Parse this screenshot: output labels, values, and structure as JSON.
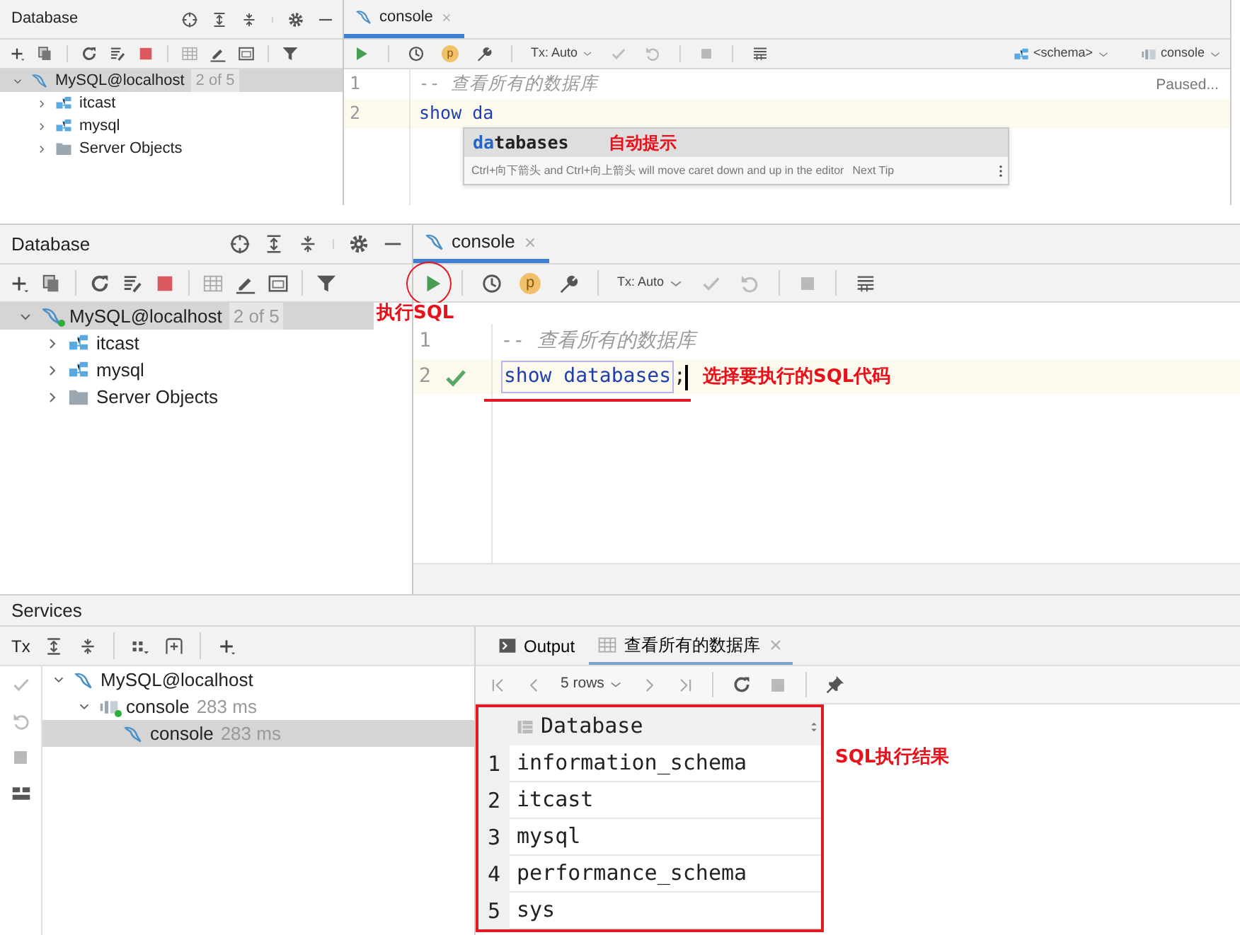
{
  "autocomplete_screenshot": {
    "database_panel": {
      "title": "Database",
      "tree": [
        {
          "label": "MySQL@localhost",
          "badge": "2 of 5",
          "kind": "connection",
          "connected": false,
          "expanded": true,
          "selected": true,
          "children": [
            {
              "label": "itcast",
              "kind": "schema",
              "expanded": false,
              "selected": false
            },
            {
              "label": "mysql",
              "kind": "schema",
              "expanded": false,
              "selected": false
            },
            {
              "label": "Server Objects",
              "kind": "folder",
              "expanded": false,
              "selected": false
            }
          ]
        }
      ]
    },
    "editor": {
      "tab": {
        "label": "console",
        "selected": true
      },
      "tx_mode": "Tx: Auto",
      "profile_badge": "p",
      "schema": "<schema>",
      "session": "console",
      "status": "Paused...",
      "lines": [
        {
          "number": "1",
          "kind": "comment",
          "text": "-- 查看所有的数据库",
          "current": false
        },
        {
          "number": "2",
          "kind": "code",
          "text": "show da",
          "current": true
        }
      ],
      "completion": {
        "item": "**da**tabases",
        "note": "自动提示",
        "hint": "Ctrl+向下箭头 and Ctrl+向上箭头 will move caret down and up in the editor",
        "link": "Next Tip"
      }
    }
  },
  "execute_screenshot": {
    "database_panel": {
      "title": "Database",
      "tree": [
        {
          "label": "MySQL@localhost",
          "badge": "2 of 5",
          "kind": "connection",
          "connected": true,
          "expanded": true,
          "selected": true,
          "children": [
            {
              "label": "itcast",
              "kind": "schema",
              "expanded": false,
              "selected": false
            },
            {
              "label": "mysql",
              "kind": "schema",
              "expanded": false,
              "selected": false
            },
            {
              "label": "Server Objects",
              "kind": "folder",
              "expanded": false,
              "selected": false
            }
          ]
        }
      ]
    },
    "editor": {
      "tab": {
        "label": "console",
        "selected": true
      },
      "tx_mode": "Tx: Auto",
      "profile_badge": "p",
      "run_note": "执行SQL",
      "lines": [
        {
          "number": "1",
          "kind": "comment",
          "text": "-- 查看所有的数据库",
          "current": false
        },
        {
          "number": "2",
          "kind": "code",
          "text": "show databases",
          "after": ";",
          "current": true,
          "executed": true,
          "selected": true,
          "caret": true,
          "note": "选择要执行的SQL代码"
        }
      ]
    },
    "services": {
      "title": "Services",
      "tx_label": "Tx",
      "tree": [
        {
          "label": "MySQL@localhost",
          "kind": "connection",
          "connected": false,
          "expanded": true,
          "selected": false,
          "children": [
            {
              "label": "console",
              "time": "283 ms",
              "kind": "session",
              "connected": true,
              "expanded": true,
              "selected": false,
              "children": [
                {
                  "label": "console",
                  "time": "283 ms",
                  "kind": "console",
                  "selected": true
                }
              ]
            }
          ]
        }
      ],
      "result_tabs": [
        {
          "label": "Output",
          "kind": "output",
          "selected": false
        },
        {
          "label": "查看所有的数据库",
          "kind": "result",
          "selected": true
        }
      ],
      "rows_label": "5 rows",
      "table": {
        "columns": [
          "Database"
        ],
        "rows": [
          {
            "number": "1",
            "cells": [
              "information_schema"
            ]
          },
          {
            "number": "2",
            "cells": [
              "itcast"
            ]
          },
          {
            "number": "3",
            "cells": [
              "mysql"
            ]
          },
          {
            "number": "4",
            "cells": [
              "performance_schema"
            ]
          },
          {
            "number": "5",
            "cells": [
              "sys"
            ]
          }
        ]
      },
      "result_note": "SQL执行结果"
    }
  }
}
